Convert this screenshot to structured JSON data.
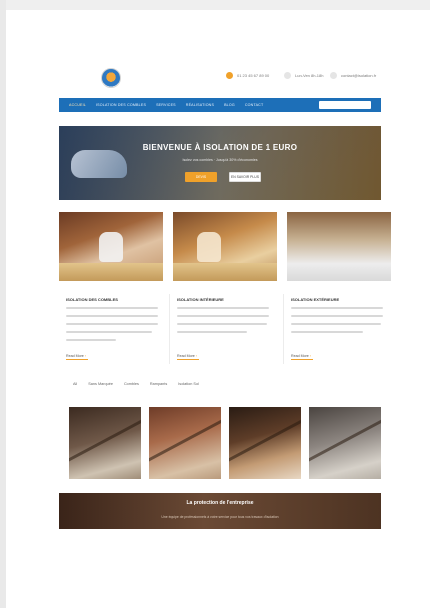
{
  "header": {
    "contacts": [
      {
        "icon": "phone-icon",
        "text": "01 23 45 67 89 00"
      },
      {
        "icon": "clock-icon",
        "text": "Lun-Ven 8h-18h"
      },
      {
        "icon": "mail-icon",
        "text": "contact@isolation.fr"
      }
    ]
  },
  "nav": {
    "items": [
      "ACCUEIL",
      "ISOLATION DES COMBLES",
      "SERVICES",
      "RÉALISATIONS",
      "BLOG",
      "CONTACT"
    ],
    "active_index": 0,
    "search_placeholder": ""
  },
  "hero": {
    "title": "BIENVENUE À ISOLATION DE 1 EURO",
    "subtitle": "Isolez vos combles · Jusqu'à 30% d'économies",
    "primary_button": "DEVIS",
    "secondary_button": "EN SAVOIR PLUS"
  },
  "services": [
    {
      "title": "ISOLATION DES COMBLES",
      "link": "Read More"
    },
    {
      "title": "ISOLATION INTÉRIEURE",
      "link": "Read More"
    },
    {
      "title": "ISOLATION EXTÉRIEURE",
      "link": "Read More"
    }
  ],
  "filters": [
    "All",
    "Sans Marquée",
    "Combles",
    "Rampants",
    "Isolation Sol"
  ],
  "banner": {
    "title": "La protection de l'entreprise",
    "subtitle": "Une équipe de professionnels à votre service pour tous vos travaux d'isolation"
  },
  "colors": {
    "nav": "#1d6fb8",
    "accent": "#f0a12a"
  }
}
